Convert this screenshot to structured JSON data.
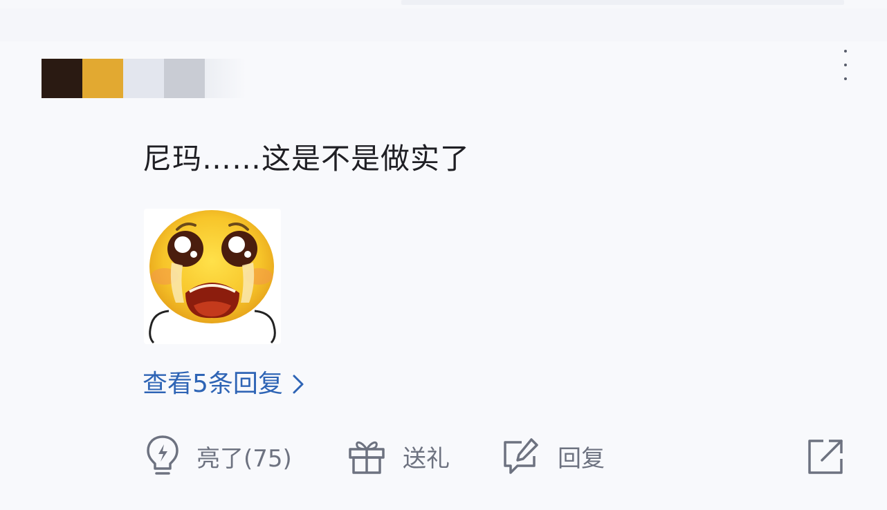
{
  "comment": {
    "text": "尼玛……这是不是做实了",
    "user_mask_colors": [
      "#2a1a12",
      "#e2a931",
      "#e3e6ee",
      "#c9ccd4"
    ],
    "sticker_icon": "crying-face-sticker"
  },
  "replies": {
    "view_label": "查看5条回复"
  },
  "actions": {
    "like_label": "亮了(75)",
    "gift_label": "送礼",
    "reply_label": "回复",
    "like_icon": "lightbulb-icon",
    "gift_icon": "gift-icon",
    "reply_icon": "comment-edit-icon",
    "share_icon": "share-icon"
  },
  "colors": {
    "link": "#2e64b5",
    "text": "#1f1f24",
    "muted": "#6d7280"
  }
}
